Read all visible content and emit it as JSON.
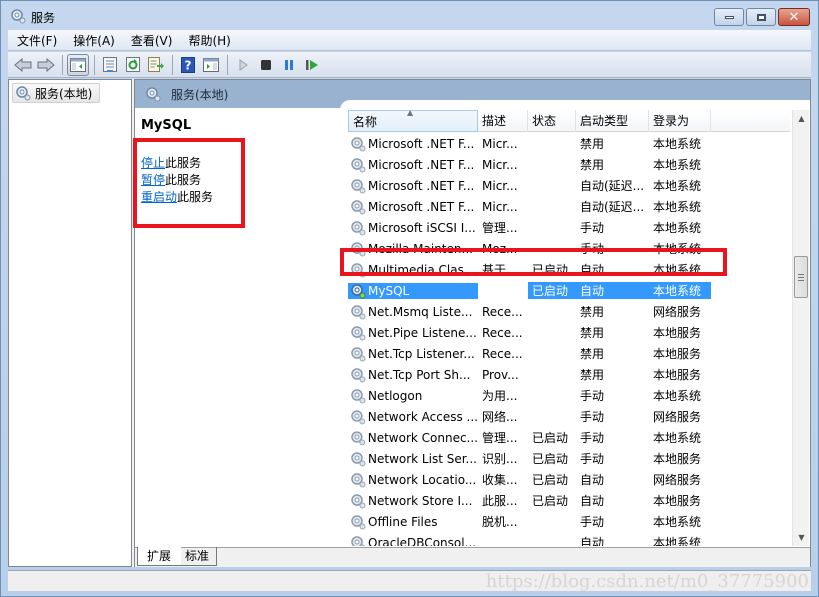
{
  "window": {
    "title": "服务",
    "controls": {
      "minimize": "minimize",
      "maximize": "maximize",
      "close": "close"
    }
  },
  "menu": {
    "items": [
      {
        "label": "文件(F)"
      },
      {
        "label": "操作(A)"
      },
      {
        "label": "查看(V)"
      },
      {
        "label": "帮助(H)"
      }
    ]
  },
  "toolbar": {
    "buttons": [
      "back-arrow",
      "forward-arrow",
      "show-hide-console-tree",
      "properties",
      "refresh",
      "export-list",
      "help",
      "show-hide-action-pane",
      "start-service",
      "stop-service",
      "pause-service",
      "restart-service"
    ]
  },
  "tree": {
    "root_label": "服务(本地)"
  },
  "right_pane": {
    "header": "服务(本地)",
    "selected_service": "MySQL",
    "actions": [
      {
        "link": "停止",
        "suffix": "此服务"
      },
      {
        "link": "暂停",
        "suffix": "此服务"
      },
      {
        "link": "重启动",
        "suffix": "此服务"
      }
    ]
  },
  "list": {
    "columns": [
      "名称",
      "描述",
      "状态",
      "启动类型",
      "登录为"
    ],
    "sorted_column": "名称",
    "rows": [
      {
        "name": "Microsoft .NET F...",
        "desc": "Micr...",
        "status": "",
        "startup": "禁用",
        "logon": "本地系统"
      },
      {
        "name": "Microsoft .NET F...",
        "desc": "Micr...",
        "status": "",
        "startup": "禁用",
        "logon": "本地系统"
      },
      {
        "name": "Microsoft .NET F...",
        "desc": "Micr...",
        "status": "",
        "startup": "自动(延迟...",
        "logon": "本地系统"
      },
      {
        "name": "Microsoft .NET F...",
        "desc": "Micr...",
        "status": "",
        "startup": "自动(延迟...",
        "logon": "本地系统"
      },
      {
        "name": "Microsoft iSCSI I...",
        "desc": "管理...",
        "status": "",
        "startup": "手动",
        "logon": "本地系统"
      },
      {
        "name": "Mozilla Mainten...",
        "desc": "Moz...",
        "status": "",
        "startup": "手动",
        "logon": "本地系统"
      },
      {
        "name": "Multimedia Clas...",
        "desc": "基于...",
        "status": "已启动",
        "startup": "自动",
        "logon": "本地系统"
      },
      {
        "name": "MySQL",
        "desc": "",
        "status": "已启动",
        "startup": "自动",
        "logon": "本地系统",
        "selected": true
      },
      {
        "name": "Net.Msmq Liste...",
        "desc": "Rece...",
        "status": "",
        "startup": "禁用",
        "logon": "网络服务"
      },
      {
        "name": "Net.Pipe Listene...",
        "desc": "Rece...",
        "status": "",
        "startup": "禁用",
        "logon": "本地服务"
      },
      {
        "name": "Net.Tcp Listener...",
        "desc": "Rece...",
        "status": "",
        "startup": "禁用",
        "logon": "本地服务"
      },
      {
        "name": "Net.Tcp Port Sh...",
        "desc": "Prov...",
        "status": "",
        "startup": "禁用",
        "logon": "本地服务"
      },
      {
        "name": "Netlogon",
        "desc": "为用...",
        "status": "",
        "startup": "手动",
        "logon": "本地系统"
      },
      {
        "name": "Network Access ...",
        "desc": "网络...",
        "status": "",
        "startup": "手动",
        "logon": "网络服务"
      },
      {
        "name": "Network Connec...",
        "desc": "管理...",
        "status": "已启动",
        "startup": "手动",
        "logon": "本地系统"
      },
      {
        "name": "Network List Ser...",
        "desc": "识别...",
        "status": "已启动",
        "startup": "手动",
        "logon": "本地服务"
      },
      {
        "name": "Network Locatio...",
        "desc": "收集...",
        "status": "已启动",
        "startup": "自动",
        "logon": "网络服务"
      },
      {
        "name": "Network Store I...",
        "desc": "此服...",
        "status": "已启动",
        "startup": "自动",
        "logon": "本地服务"
      },
      {
        "name": "Offline Files",
        "desc": "脱机...",
        "status": "",
        "startup": "手动",
        "logon": "本地系统"
      },
      {
        "name": "OracleDBConsol...",
        "desc": "",
        "status": "",
        "startup": "自动",
        "logon": "本地系统"
      }
    ]
  },
  "tabs": [
    {
      "label": "扩展",
      "active": true
    },
    {
      "label": "标准",
      "active": false
    }
  ],
  "statusbar": {
    "watermark": "https://blog.csdn.net/m0_37775900"
  },
  "colors": {
    "selection": "#3399ff",
    "annotation_red": "#e8151c",
    "link": "#0066cc",
    "pane_header": "#98b2cf"
  }
}
